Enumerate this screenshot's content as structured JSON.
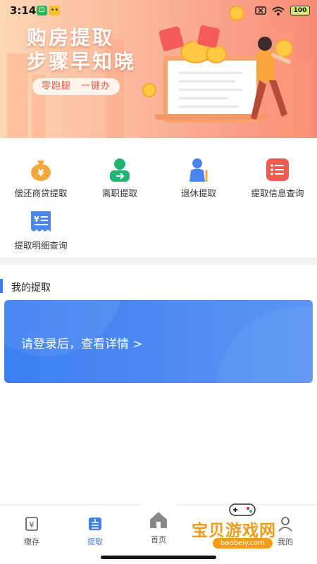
{
  "status_bar": {
    "time": "3:14",
    "battery": "100"
  },
  "banner": {
    "headline_line1": "购房提取",
    "headline_line2": "步骤早知晓",
    "pill": "零跑腿　一键办"
  },
  "services": [
    {
      "label": "偿还商贷提取",
      "icon": "money-bag-icon",
      "color": "#f5a63a"
    },
    {
      "label": "离职提取",
      "icon": "user-exit-icon",
      "color": "#1fb571"
    },
    {
      "label": "退休提取",
      "icon": "elder-person-icon",
      "color": "#4a86ee"
    },
    {
      "label": "提取信息查询",
      "icon": "list-icon",
      "color": "#ef5b4f"
    },
    {
      "label": "提取明细查询",
      "icon": "receipt-icon",
      "color": "#4a86ee"
    }
  ],
  "my_section": {
    "title": "我的提取",
    "login_prompt": "请登录后，查看详情 >"
  },
  "tabbar": {
    "tabs": [
      {
        "label": "缴存",
        "active": false
      },
      {
        "label": "提取",
        "active": true
      },
      {
        "label": "首页",
        "active": false
      },
      {
        "label": "我的",
        "active": false
      }
    ],
    "accent": "#3b7ff0"
  },
  "watermark": {
    "text": "宝贝游戏网",
    "url": "baobeiy.com"
  }
}
